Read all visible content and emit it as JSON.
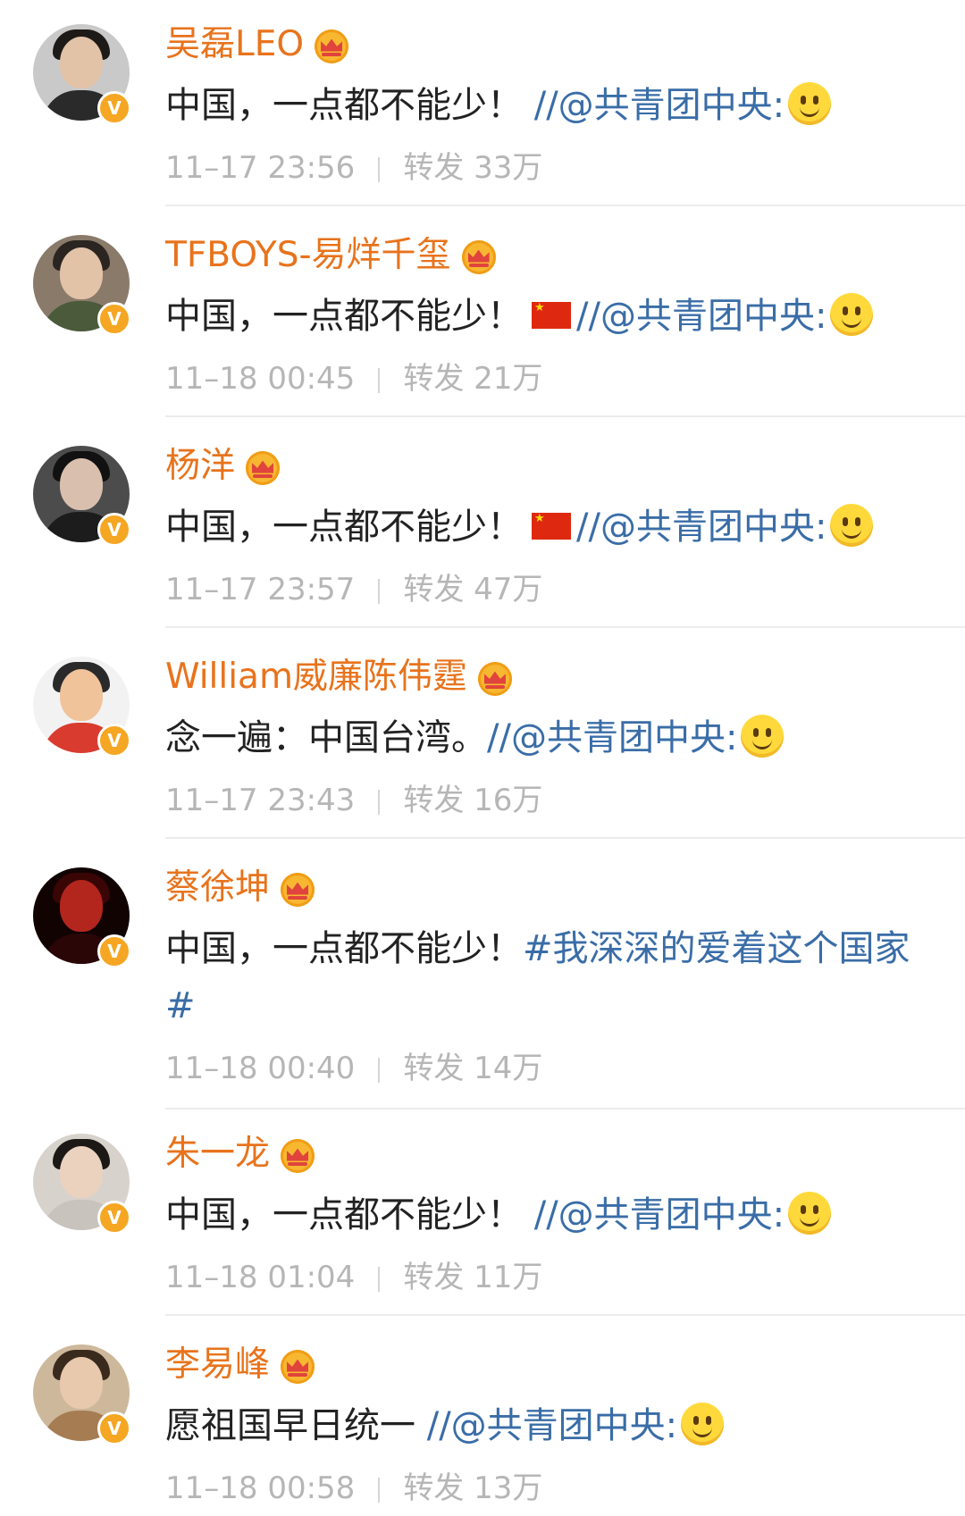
{
  "colors": {
    "username": "#e8731c",
    "link": "#3a6da7",
    "body_text": "#222222",
    "meta_text": "#b6b6b6",
    "verified_badge": "#f5a623"
  },
  "posts": [
    {
      "username": "吴磊LEO",
      "text_prefix": "中国，一点都不能少！",
      "link_text": "//@共青团中央:",
      "timestamp": "11–17 23:56",
      "repost_label": "转发",
      "repost_count": "33万",
      "icons": [
        "crown-icon",
        "verified-v-icon",
        "smile-emoji-icon"
      ]
    },
    {
      "username": "TFBOYS-易烊千玺",
      "text_prefix": "中国，一点都不能少！",
      "link_text": "//@共青团中央:",
      "timestamp": "11–18 00:45",
      "repost_label": "转发",
      "repost_count": "21万",
      "icons": [
        "crown-icon",
        "verified-v-icon",
        "china-flag-icon",
        "smile-emoji-icon"
      ]
    },
    {
      "username": "杨洋",
      "text_prefix": "中国，一点都不能少！",
      "link_text": "//@共青团中央:",
      "timestamp": "11–17 23:57",
      "repost_label": "转发",
      "repost_count": "47万",
      "icons": [
        "crown-icon",
        "verified-v-icon",
        "china-flag-icon",
        "smile-emoji-icon"
      ]
    },
    {
      "username": "William威廉陈伟霆",
      "text_prefix": "念一遍：中国台湾。",
      "link_text": "//@共青团中央:",
      "timestamp": "11–17 23:43",
      "repost_label": "转发",
      "repost_count": "16万",
      "icons": [
        "crown-icon",
        "verified-v-icon",
        "smile-emoji-icon"
      ]
    },
    {
      "username": "蔡徐坤",
      "text_prefix": "中国，一点都不能少！",
      "link_text": "#我深深的爱着这个国家#",
      "timestamp": "11–18 00:40",
      "repost_label": "转发",
      "repost_count": "14万",
      "icons": [
        "crown-icon",
        "verified-v-icon"
      ]
    },
    {
      "username": "朱一龙",
      "text_prefix": "中国，一点都不能少！",
      "link_text": "//@共青团中央:",
      "timestamp": "11–18 01:04",
      "repost_label": "转发",
      "repost_count": "11万",
      "icons": [
        "crown-icon",
        "verified-v-icon",
        "smile-emoji-icon"
      ]
    },
    {
      "username": "李易峰",
      "text_prefix": "愿祖国早日统一",
      "link_text": "//@共青团中央:",
      "timestamp": "11–18 00:58",
      "repost_label": "转发",
      "repost_count": "13万",
      "icons": [
        "crown-icon",
        "verified-v-icon",
        "smile-emoji-icon"
      ]
    }
  ]
}
